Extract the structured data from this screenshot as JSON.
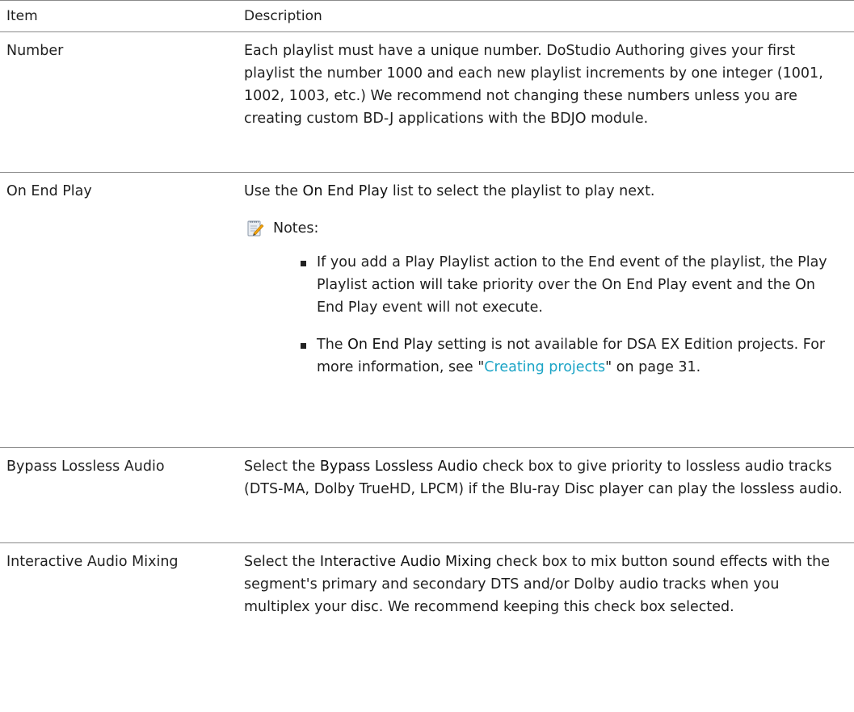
{
  "header": {
    "item": "Item",
    "description": "Description"
  },
  "rows": [
    {
      "item": "Number",
      "text": "Each playlist must have a unique number. DoStudio Authoring gives your first playlist the number 1000 and each new playlist increments by one integer (1001, 1002, 1003, etc.) We recommend not changing these numbers unless you are creating custom BD-J applications with the BDJO module."
    },
    {
      "item": "On End Play",
      "intro_pre": "Use the ",
      "intro_bold": "On End Play",
      "intro_post": " list to select the playlist to play next.",
      "notes_label": "Notes:",
      "bullet1": "If you add a Play Playlist action to the End event of the playlist, the Play Playlist action will take priority over the On End Play event and the On End Play event will not execute.",
      "bullet2_pre": "The ",
      "bullet2_bold": "On End Play",
      "bullet2_mid": " setting is not available for DSA EX Edition projects. For more information, see \"",
      "bullet2_link": "Creating projects",
      "bullet2_post": "\" on page 31."
    },
    {
      "item": "Bypass Lossless Audio",
      "pre": "Select the ",
      "bold": "Bypass Lossless Audio",
      "post": " check box to give priority to lossless audio tracks (DTS-MA, Dolby TrueHD, LPCM) if the Blu-ray Disc player can play the lossless audio."
    },
    {
      "item": "Interactive Audio Mixing",
      "pre": "Select the ",
      "bold": "Interactive Audio Mixing",
      "post": " check box to mix button sound effects with the segment's primary and secondary DTS and/or Dolby audio tracks when you multiplex your disc. We recommend keeping this check box selected."
    }
  ],
  "colors": {
    "link": "#1ba4c6",
    "rule": "#8a8a8a"
  },
  "icons": {
    "note": "notepad-pencil-icon"
  }
}
